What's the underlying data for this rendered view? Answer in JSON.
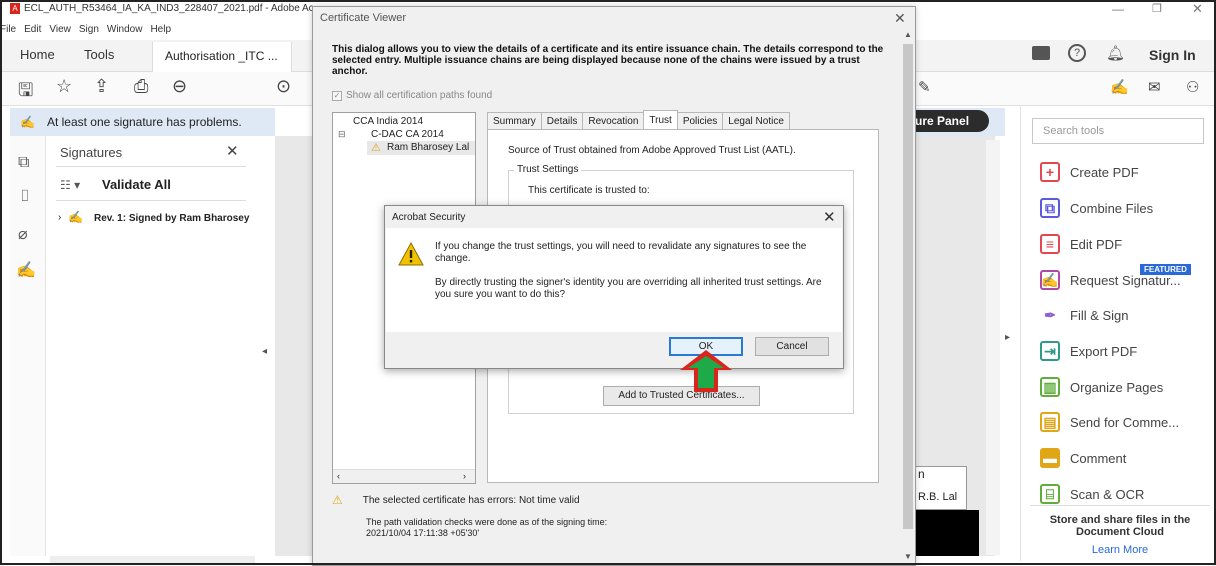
{
  "window": {
    "title": "ECL_AUTH_R53464_IA_KA_IND3_228407_2021.pdf - Adobe Ac",
    "menu": [
      "File",
      "Edit",
      "View",
      "Sign",
      "Window",
      "Help"
    ]
  },
  "tabs": {
    "home": "Home",
    "tools": "Tools",
    "document": "Authorisation _ITC ...",
    "sign_in": "Sign In"
  },
  "signature_bar": {
    "message": "At least one signature has problems.",
    "panel_button": "ure Panel"
  },
  "signatures_panel": {
    "title": "Signatures",
    "validate_all": "Validate All",
    "revision": "Rev. 1: Signed by Ram Bharosey"
  },
  "right_pane": {
    "search_placeholder": "Search tools",
    "tools": [
      {
        "label": "Create PDF",
        "color": "#e34850"
      },
      {
        "label": "Combine Files",
        "color": "#5a5ae0"
      },
      {
        "label": "Edit PDF",
        "color": "#e34850"
      },
      {
        "label": "Request Signatur...",
        "color": "#b04aa8"
      },
      {
        "label": "Fill & Sign",
        "color": "#8a5fd6"
      },
      {
        "label": "Export PDF",
        "color": "#2e9a8a"
      },
      {
        "label": "Organize Pages",
        "color": "#5fae3a"
      },
      {
        "label": "Send for Comme...",
        "color": "#e0a617"
      },
      {
        "label": "Comment",
        "color": "#e0a617"
      },
      {
        "label": "Scan & OCR",
        "color": "#5fae3a"
      }
    ],
    "featured_badge": "FEATURED",
    "cloud_text": "Store and share files in the Document Cloud",
    "learn_more": "Learn More"
  },
  "document_fragments": {
    "signer_snippet": "R.B. Lal",
    "letter": "n"
  },
  "certificate_viewer": {
    "title": "Certificate Viewer",
    "description": "This dialog allows you to view the details of a certificate and its entire issuance chain. The details correspond to the selected entry. Multiple issuance chains are being displayed because none of the chains were issued by a trust anchor.",
    "show_all_paths": "Show all certification paths found",
    "tree": [
      "CCA India 2014",
      "C-DAC CA 2014",
      "Ram Bharosey Lal"
    ],
    "tabs": [
      "Summary",
      "Details",
      "Revocation",
      "Trust",
      "Policies",
      "Legal Notice"
    ],
    "active_tab": "Trust",
    "trust_source": "Source of Trust obtained from Adobe Approved Trust List (AATL).",
    "trust_settings_label": "Trust Settings",
    "trusted_to": "This certificate is trusted to:",
    "add_trusted_button": "Add to Trusted Certificates...",
    "error_message": "The selected certificate has errors: Not time valid",
    "path_check_text": "The path validation checks were done as of the signing time:",
    "path_check_time": "2021/10/04 17:11:38 +05'30'"
  },
  "alert": {
    "title": "Acrobat Security",
    "message1": "If you change the trust settings, you will need to revalidate any signatures to see the change.",
    "message2": "By directly trusting the signer's identity you are overriding all inherited trust settings. Are you sure you want to do this?",
    "ok_label": "OK",
    "cancel_label": "Cancel"
  }
}
